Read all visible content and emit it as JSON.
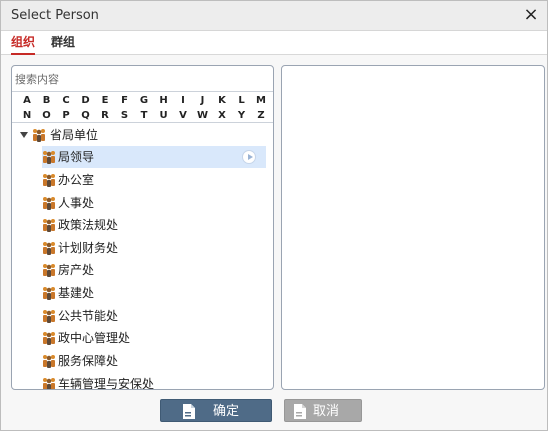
{
  "window": {
    "title": "Select Person",
    "close_glyph": "×"
  },
  "tabs": [
    {
      "label": "组织",
      "active": true
    },
    {
      "label": "群组",
      "active": false
    }
  ],
  "search": {
    "placeholder": "搜索内容",
    "value": ""
  },
  "alphabet": {
    "row1": [
      "A",
      "B",
      "C",
      "D",
      "E",
      "F",
      "G",
      "H",
      "I",
      "J",
      "K",
      "L",
      "M"
    ],
    "row2": [
      "N",
      "O",
      "P",
      "Q",
      "R",
      "S",
      "T",
      "U",
      "V",
      "W",
      "X",
      "Y",
      "Z"
    ]
  },
  "tree": {
    "root": {
      "label": "省局单位",
      "expanded": true,
      "icon": "group-icon"
    },
    "children": [
      {
        "label": "局领导",
        "selected": true
      },
      {
        "label": "办公室"
      },
      {
        "label": "人事处"
      },
      {
        "label": "政策法规处"
      },
      {
        "label": "计划财务处"
      },
      {
        "label": "房产处"
      },
      {
        "label": "基建处"
      },
      {
        "label": "公共节能处"
      },
      {
        "label": "政中心管理处"
      },
      {
        "label": "服务保障处"
      },
      {
        "label": "车辆管理与安保处"
      }
    ]
  },
  "buttons": {
    "ok": "确定",
    "cancel": "取消"
  },
  "colors": {
    "accent_red": "#c62a26",
    "ok_button": "#4f6b87",
    "cancel_button": "#a8a8a8",
    "selected_row": "#d9e8fb",
    "panel_border": "#9aa4b2"
  }
}
